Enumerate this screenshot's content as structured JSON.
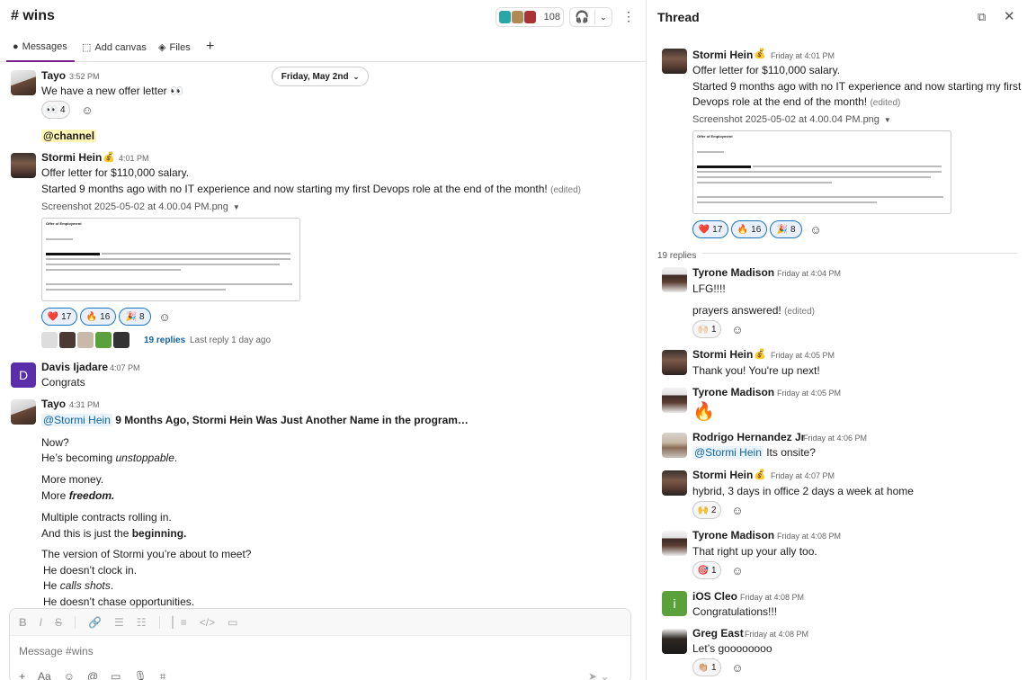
{
  "channel": {
    "title": "# wins",
    "member_count": "108",
    "tabs": {
      "messages": "Messages",
      "add_canvas": "Add canvas",
      "files": "Files"
    },
    "date_divider": "Friday, May 2nd",
    "messages": [
      {
        "author": "Tayo",
        "time": "3:52 PM",
        "text": "We have a new offer letter 👀",
        "reactions": [
          {
            "emoji": "👀",
            "count": "4"
          }
        ]
      },
      {
        "text": "@channel"
      },
      {
        "author": "Stormi Hein",
        "status_emoji": "💰",
        "time": "4:01 PM",
        "line1": "Offer letter for $110,000 salary.",
        "line2": "Started 9 months ago with no IT experience and now starting my first Devops role at the end of the month!",
        "edited": "(edited)",
        "file_name": "Screenshot 2025-05-02 at 4.00.04 PM.png",
        "doc_title": "Offer of Employment",
        "reactions": [
          {
            "emoji": "❤️",
            "count": "17"
          },
          {
            "emoji": "🔥",
            "count": "16"
          },
          {
            "emoji": "🎉",
            "count": "8"
          }
        ],
        "replies": "19 replies",
        "last_reply": "Last reply 1 day ago"
      },
      {
        "author": "Davis Ijadare",
        "avatar_letter": "D",
        "time": "4:07 PM",
        "text": "Congrats"
      },
      {
        "author": "Tayo",
        "time": "4:31 PM",
        "mention": "@Stormi Hein",
        "headline": "9 Months Ago, Stormi Hein Was Just Another Name in the program…",
        "p1": "Now?",
        "p2_a": "He’s becoming ",
        "p2_b": "unstoppable",
        "p2_c": ".",
        "p3": "More money.",
        "p4_a": "More ",
        "p4_b": "freedom.",
        "p5": "Multiple contracts rolling in.",
        "p6_a": "And this is just the ",
        "p6_b": "beginning.",
        "p7": "The version of Stormi you’re about to meet?",
        "p8": "He doesn’t clock in.",
        "p9_a": "He ",
        "p9_b": "calls shots",
        "p9_c": ".",
        "p10": "He doesn’t chase opportunities."
      }
    ],
    "composer_placeholder": "Message #wins"
  },
  "thread": {
    "title": "Thread",
    "parent": {
      "author": "Stormi Hein",
      "status_emoji": "💰",
      "time": "Friday at 4:01 PM",
      "line1": "Offer letter for $110,000 salary.",
      "line2": "Started 9 months ago with no IT experience and now starting my first",
      "line3": "Devops role at the end of the month!",
      "edited": "(edited)",
      "file_name": "Screenshot 2025-05-02 at 4.00.04 PM.png",
      "doc_title": "Offer of Employment",
      "reactions": [
        {
          "emoji": "❤️",
          "count": "17"
        },
        {
          "emoji": "🔥",
          "count": "16"
        },
        {
          "emoji": "🎉",
          "count": "8"
        }
      ]
    },
    "reply_count": "19 replies",
    "replies": [
      {
        "author": "Tyrone Madison",
        "time": "Friday at 4:04 PM",
        "text": "LFG!!!!",
        "text2": "prayers answered!",
        "edited": "(edited)",
        "reactions": [
          {
            "emoji": "🙌🏻",
            "count": "1"
          }
        ]
      },
      {
        "author": "Stormi Hein",
        "status_emoji": "💰",
        "time": "Friday at 4:05 PM",
        "text": "Thank you! You're up next!"
      },
      {
        "author": "Tyrone Madison",
        "time": "Friday at 4:05 PM",
        "text": "🔥"
      },
      {
        "author": "Rodrigo Hernandez Jr",
        "time": "Friday at 4:06 PM",
        "mention": "@Stormi Hein",
        "text": " Its onsite?"
      },
      {
        "author": "Stormi Hein",
        "status_emoji": "💰",
        "time": "Friday at 4:07 PM",
        "text": "hybrid, 3 days in office 2 days a week at home",
        "reactions": [
          {
            "emoji": "🙌",
            "count": "2"
          }
        ]
      },
      {
        "author": "Tyrone Madison",
        "time": "Friday at 4:08 PM",
        "text": "That right up your ally too.",
        "reactions": [
          {
            "emoji": "🎯",
            "count": "1"
          }
        ]
      },
      {
        "author": "iOS Cleo",
        "avatar_letter": "i",
        "time": "Friday at 4:08 PM",
        "text": "Congratulations!!!"
      },
      {
        "author": "Greg East",
        "time": "Friday at 4:08 PM",
        "text": "Let’s goooooooo",
        "reactions": [
          {
            "emoji": "👏🏼",
            "count": "1"
          }
        ]
      }
    ]
  },
  "colors": {
    "accent": "#7a1f8a",
    "link": "#1264a3",
    "mention_bg": "#e8f3fb",
    "channel_highlight": "#fef4b4"
  }
}
